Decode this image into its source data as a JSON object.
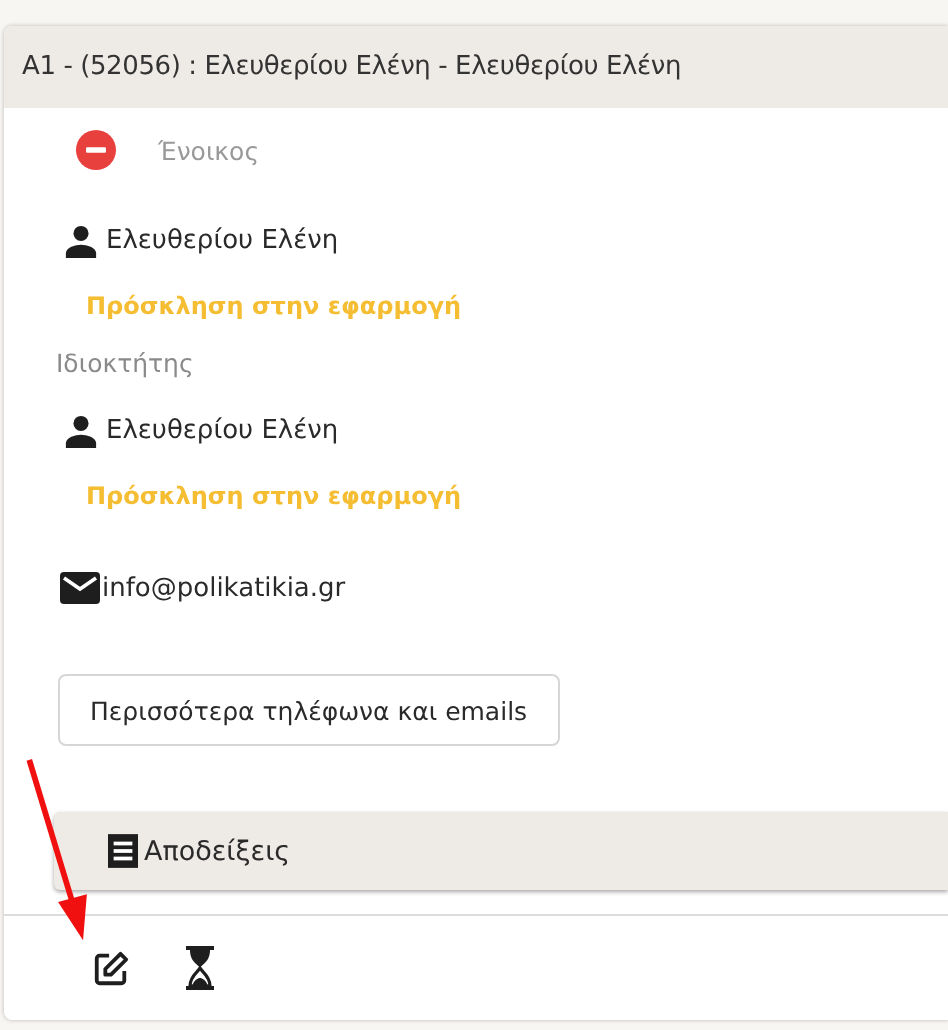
{
  "header": {
    "title": "A1 - (52056) : Ελευθερίου Ελένη - Ελευθερίου Ελένη"
  },
  "sections": [
    {
      "role": "Ένοικος",
      "kind": "tenant",
      "name": "Ελευθερίου Ελένη",
      "invite": "Πρόσκληση στην εφαρμογή"
    },
    {
      "role": "Ιδιοκτήτης",
      "kind": "owner",
      "name": "Ελευθερίου Ελένη",
      "invite": "Πρόσκληση στην εφαρμογή"
    }
  ],
  "email": "info@polikatikia.gr",
  "more_button": "Περισσότερα τηλέφωνα και emails",
  "receipts": {
    "label": "Αποδείξεις"
  }
}
